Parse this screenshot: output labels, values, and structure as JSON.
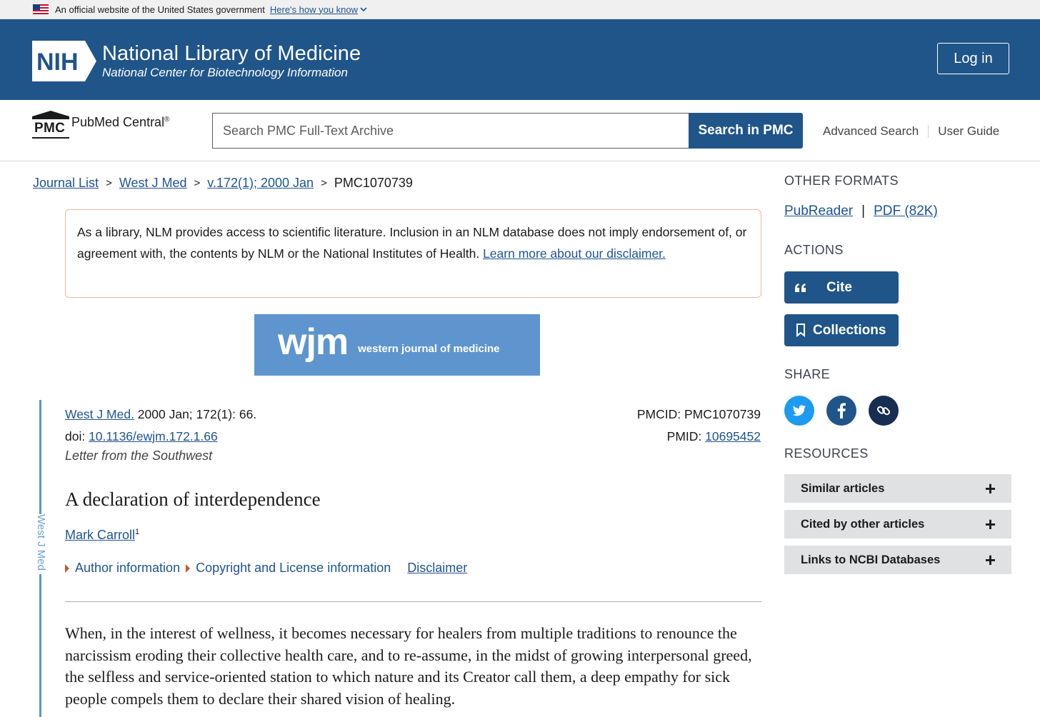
{
  "gov_banner": {
    "text": "An official website of the United States government",
    "link": "Here's how you know"
  },
  "header": {
    "logo": "NIH",
    "title": "National Library of Medicine",
    "subtitle": "National Center for Biotechnology Information",
    "login": "Log in",
    "colors": {
      "header_bg": "#20558a"
    }
  },
  "search": {
    "logo_letters": "PMC",
    "logo_name": "PubMed Central",
    "logo_reg": "®",
    "placeholder": "Search PMC Full-Text Archive",
    "button": "Search in PMC",
    "advanced": "Advanced Search",
    "guide": "User Guide"
  },
  "breadcrumb": {
    "items": [
      "Journal List",
      "West J Med",
      "v.172(1); 2000 Jan"
    ],
    "separator": ">",
    "current": "PMC1070739"
  },
  "disclaimer": {
    "text": "As a library, NLM provides access to scientific literature. Inclusion in an NLM database does not imply endorsement of, or agreement with, the contents by NLM or the National Institutes of Health. ",
    "link": "Learn more about our disclaimer."
  },
  "journal_banner": {
    "big": "wjm",
    "small": "western journal of medicine"
  },
  "side_label": "West J Med",
  "citation": {
    "journal": "West J Med.",
    "details": " 2000 Jan; 172(1): 66.",
    "doi_label": "doi: ",
    "doi": "10.1136/ewjm.172.1.66",
    "pmcid_label": "PMCID: ",
    "pmcid": "PMC1070739",
    "pmid_label": "PMID: ",
    "pmid": "10695452",
    "article_type": "Letter from the Southwest"
  },
  "article": {
    "title": "A declaration of interdependence",
    "author": "Mark Carroll",
    "author_sup": "1",
    "author_info": "Author information",
    "copyright": "Copyright and License information",
    "disclaimer": "Disclaimer",
    "body": "When, in the interest of wellness, it becomes necessary for healers from multiple traditions to renounce the narcissism eroding their collective health care, and to re-assume, in the midst of growing interpersonal greed, the selfless and service-oriented station to which nature and its Creator call them, a deep empathy for sick people compels them to declare their shared vision of healing."
  },
  "sidebar": {
    "other_formats": "OTHER FORMATS",
    "pubreader": "PubReader",
    "format_sep": "|",
    "pdf": "PDF (82K)",
    "actions": "ACTIONS",
    "cite": "Cite",
    "collections": "Collections",
    "share": "SHARE",
    "share_icons": [
      "twitter-icon",
      "facebook-icon",
      "link-icon"
    ],
    "resources": "RESOURCES",
    "resource_items": [
      "Similar articles",
      "Cited by other articles",
      "Links to NCBI Databases"
    ]
  }
}
